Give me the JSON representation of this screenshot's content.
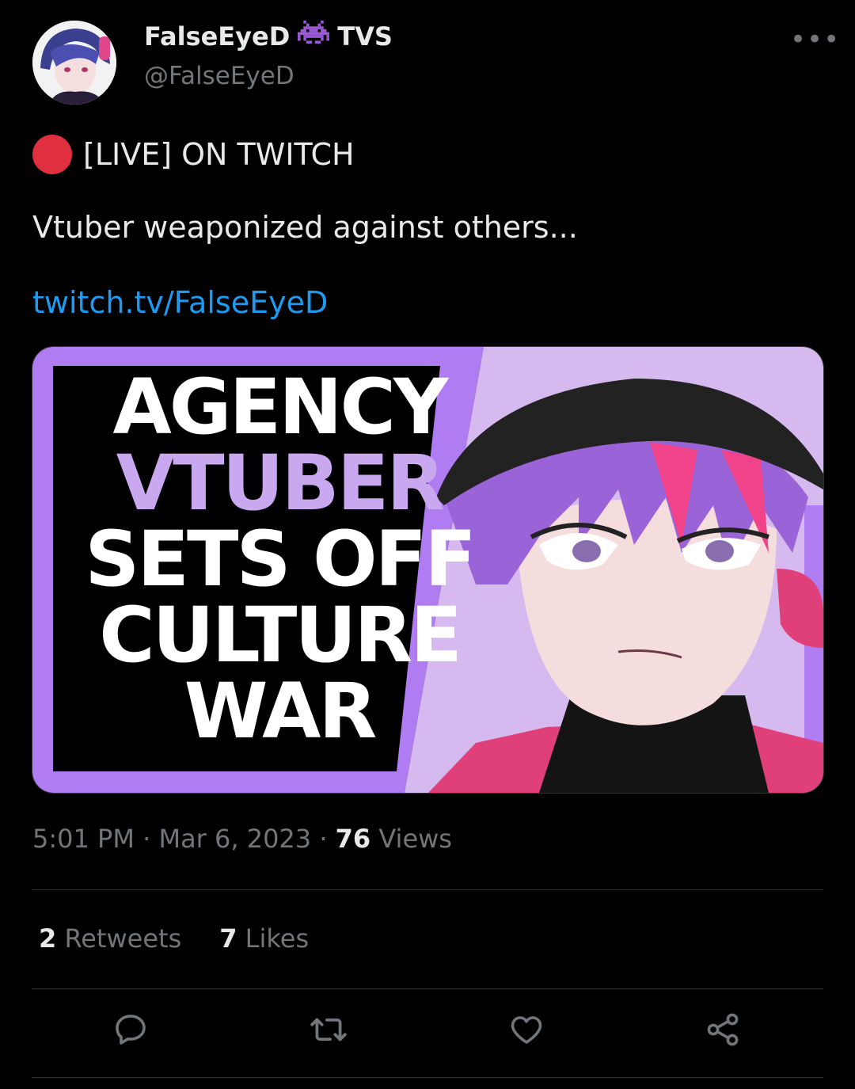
{
  "author": {
    "display_name": "FalseEyeD",
    "name_suffix": "TVS",
    "handle": "@FalseEyeD",
    "badge_icon": "space-invader-icon"
  },
  "more_label": "•••",
  "tweet": {
    "live_line": "[LIVE] ON TWITCH",
    "text": "Vtuber weaponized against others...",
    "link": "twitch.tv/FalseEyeD"
  },
  "media": {
    "title_lines": [
      "AGENCY",
      "VTUBER",
      "SETS OFF",
      "CULTURE",
      "WAR"
    ],
    "accent_color": "#b07cf2",
    "title_purple": "#c9a8f0"
  },
  "meta": {
    "time": "5:01 PM",
    "sep1": "·",
    "date": "Mar 6, 2023",
    "sep2": "·",
    "views_count": "76",
    "views_label": "Views"
  },
  "stats": {
    "retweets_count": "2",
    "retweets_label": "Retweets",
    "likes_count": "7",
    "likes_label": "Likes"
  },
  "colors": {
    "background": "#000000",
    "text": "#e7e9ea",
    "muted": "#71767b",
    "link": "#1d9bf0",
    "live_dot": "#e0303f"
  }
}
